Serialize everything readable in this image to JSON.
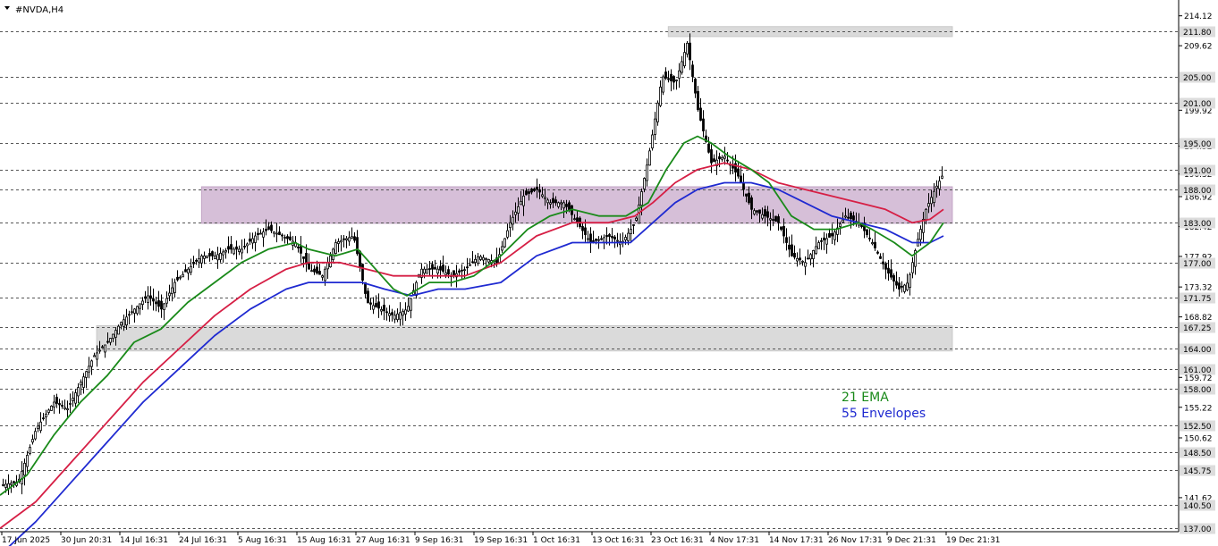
{
  "chart_data": {
    "type": "candlestick",
    "title": "#NVDA,H4",
    "colors": {
      "background": "#ffffff",
      "axis": "#000000",
      "grid_dash": "#555555",
      "candle": "#000000",
      "ema21": "#1a8a1a",
      "ema_red": "#d61f45",
      "env55": "#1f2ad1",
      "resistance_zone": "#d6bfd8",
      "gray_zone": "#dadada",
      "badge": "#dcdcdc"
    },
    "ylim": [
      136.5,
      216.5
    ],
    "y_ticks": [
      "214.12",
      "209.62",
      "199.92",
      "194.52",
      "190.32",
      "186.92",
      "182.42",
      "177.92",
      "173.32",
      "168.82",
      "159.72",
      "155.22",
      "150.62",
      "141.62"
    ],
    "price_levels": [
      "211.80",
      "205.00",
      "201.00",
      "195.00",
      "191.00",
      "188.00",
      "183.00",
      "177.00",
      "171.75",
      "167.25",
      "164.00",
      "161.00",
      "158.00",
      "152.50",
      "148.50",
      "145.75",
      "140.50",
      "137.00"
    ],
    "x_ticks": [
      "17 Jun 2025",
      "30 Jun 20:31",
      "14 Jul 16:31",
      "24 Jul 16:31",
      "5 Aug 16:31",
      "15 Aug 16:31",
      "27 Aug 16:31",
      "9 Sep 16:31",
      "19 Sep 16:31",
      "1 Oct 16:31",
      "13 Oct 16:31",
      "23 Oct 16:31",
      "4 Nov 17:31",
      "14 Nov 17:31",
      "26 Nov 17:31",
      "9 Dec 21:31",
      "19 Dec 21:31"
    ],
    "zones": [
      {
        "name": "top-gray-zone",
        "from": 211.0,
        "to": 212.5,
        "start": 0.567,
        "end": 0.808
      },
      {
        "name": "purple-zone",
        "from": 182.9,
        "to": 188.4,
        "start": 0.171,
        "end": 0.808
      },
      {
        "name": "lower-gray-zone",
        "from": 163.7,
        "to": 167.5,
        "start": 0.082,
        "end": 0.808
      }
    ],
    "annotations": [
      {
        "text": "21 EMA",
        "color": "#1a8a1a"
      },
      {
        "text": "55 Envelopes",
        "color": "#1f2ad1"
      }
    ],
    "series": [
      {
        "key": "close",
        "points": [
          [
            0,
            143.5
          ],
          [
            20,
            144
          ],
          [
            40,
            152
          ],
          [
            60,
            156
          ],
          [
            75,
            155
          ],
          [
            90,
            159
          ],
          [
            105,
            163
          ],
          [
            120,
            165
          ],
          [
            135,
            168
          ],
          [
            150,
            170
          ],
          [
            165,
            172
          ],
          [
            180,
            170
          ],
          [
            195,
            174
          ],
          [
            210,
            176
          ],
          [
            225,
            178
          ],
          [
            240,
            178
          ],
          [
            255,
            179
          ],
          [
            270,
            179
          ],
          [
            285,
            181
          ],
          [
            300,
            182
          ],
          [
            315,
            181
          ],
          [
            330,
            180
          ],
          [
            345,
            176
          ],
          [
            360,
            175
          ],
          [
            375,
            180
          ],
          [
            395,
            181
          ],
          [
            410,
            171
          ],
          [
            425,
            170
          ],
          [
            440,
            169
          ],
          [
            455,
            170
          ],
          [
            470,
            176
          ],
          [
            490,
            176
          ],
          [
            505,
            175
          ],
          [
            520,
            176
          ],
          [
            535,
            178
          ],
          [
            555,
            177
          ],
          [
            570,
            183
          ],
          [
            585,
            187
          ],
          [
            600,
            188
          ],
          [
            615,
            186
          ],
          [
            630,
            186
          ],
          [
            645,
            183
          ],
          [
            660,
            180
          ],
          [
            680,
            181
          ],
          [
            695,
            180
          ],
          [
            710,
            183
          ],
          [
            725,
            193
          ],
          [
            740,
            205
          ],
          [
            755,
            204
          ],
          [
            768,
            210
          ],
          [
            780,
            200
          ],
          [
            795,
            192
          ],
          [
            810,
            193
          ],
          [
            825,
            190
          ],
          [
            840,
            185
          ],
          [
            855,
            184
          ],
          [
            870,
            183
          ],
          [
            885,
            178
          ],
          [
            900,
            177
          ],
          [
            915,
            180
          ],
          [
            930,
            181
          ],
          [
            945,
            184
          ],
          [
            960,
            183
          ],
          [
            975,
            180
          ],
          [
            990,
            176
          ],
          [
            1005,
            173
          ],
          [
            1015,
            174
          ],
          [
            1025,
            180
          ],
          [
            1035,
            185
          ],
          [
            1045,
            188
          ],
          [
            1053,
            190
          ]
        ]
      },
      {
        "key": "ema21",
        "points": [
          [
            0,
            142
          ],
          [
            30,
            145
          ],
          [
            60,
            151
          ],
          [
            90,
            156
          ],
          [
            120,
            160
          ],
          [
            150,
            165
          ],
          [
            180,
            167
          ],
          [
            210,
            171
          ],
          [
            240,
            174
          ],
          [
            270,
            177
          ],
          [
            300,
            179
          ],
          [
            330,
            180
          ],
          [
            345,
            179
          ],
          [
            375,
            178
          ],
          [
            400,
            179
          ],
          [
            420,
            176
          ],
          [
            440,
            173
          ],
          [
            455,
            172
          ],
          [
            480,
            174
          ],
          [
            505,
            174
          ],
          [
            530,
            175
          ],
          [
            560,
            178
          ],
          [
            590,
            182
          ],
          [
            615,
            184
          ],
          [
            640,
            185
          ],
          [
            670,
            184
          ],
          [
            700,
            184
          ],
          [
            725,
            186
          ],
          [
            745,
            191
          ],
          [
            765,
            195
          ],
          [
            780,
            196
          ],
          [
            795,
            195
          ],
          [
            815,
            193
          ],
          [
            840,
            191
          ],
          [
            860,
            189
          ],
          [
            885,
            184
          ],
          [
            910,
            182
          ],
          [
            935,
            182
          ],
          [
            960,
            183
          ],
          [
            975,
            182
          ],
          [
            1000,
            180
          ],
          [
            1020,
            178
          ],
          [
            1040,
            180
          ],
          [
            1055,
            183
          ]
        ]
      },
      {
        "key": "ema_red",
        "points": [
          [
            0,
            137
          ],
          [
            40,
            141
          ],
          [
            80,
            147
          ],
          [
            120,
            153
          ],
          [
            160,
            159
          ],
          [
            200,
            164
          ],
          [
            240,
            169
          ],
          [
            280,
            173
          ],
          [
            320,
            176
          ],
          [
            345,
            177
          ],
          [
            380,
            177
          ],
          [
            410,
            176
          ],
          [
            440,
            175
          ],
          [
            480,
            175
          ],
          [
            520,
            175
          ],
          [
            560,
            177
          ],
          [
            600,
            181
          ],
          [
            640,
            183
          ],
          [
            680,
            183
          ],
          [
            710,
            184
          ],
          [
            730,
            186
          ],
          [
            755,
            189
          ],
          [
            780,
            191
          ],
          [
            810,
            192
          ],
          [
            840,
            191
          ],
          [
            870,
            189
          ],
          [
            900,
            188
          ],
          [
            930,
            187
          ],
          [
            960,
            186
          ],
          [
            990,
            185
          ],
          [
            1020,
            183
          ],
          [
            1040,
            183.5
          ],
          [
            1055,
            185
          ]
        ]
      },
      {
        "key": "env55",
        "points": [
          [
            0,
            133
          ],
          [
            40,
            138
          ],
          [
            80,
            144
          ],
          [
            120,
            150
          ],
          [
            160,
            156
          ],
          [
            200,
            161
          ],
          [
            240,
            166
          ],
          [
            280,
            170
          ],
          [
            320,
            173
          ],
          [
            345,
            174
          ],
          [
            380,
            174
          ],
          [
            405,
            174
          ],
          [
            430,
            173
          ],
          [
            460,
            172
          ],
          [
            490,
            173
          ],
          [
            520,
            173
          ],
          [
            560,
            174
          ],
          [
            600,
            178
          ],
          [
            640,
            180
          ],
          [
            680,
            180
          ],
          [
            705,
            180
          ],
          [
            730,
            183
          ],
          [
            755,
            186
          ],
          [
            780,
            188
          ],
          [
            810,
            189
          ],
          [
            840,
            189
          ],
          [
            870,
            188
          ],
          [
            900,
            186
          ],
          [
            930,
            184
          ],
          [
            960,
            183
          ],
          [
            990,
            182
          ],
          [
            1020,
            180
          ],
          [
            1040,
            180
          ],
          [
            1055,
            181
          ]
        ]
      }
    ]
  }
}
